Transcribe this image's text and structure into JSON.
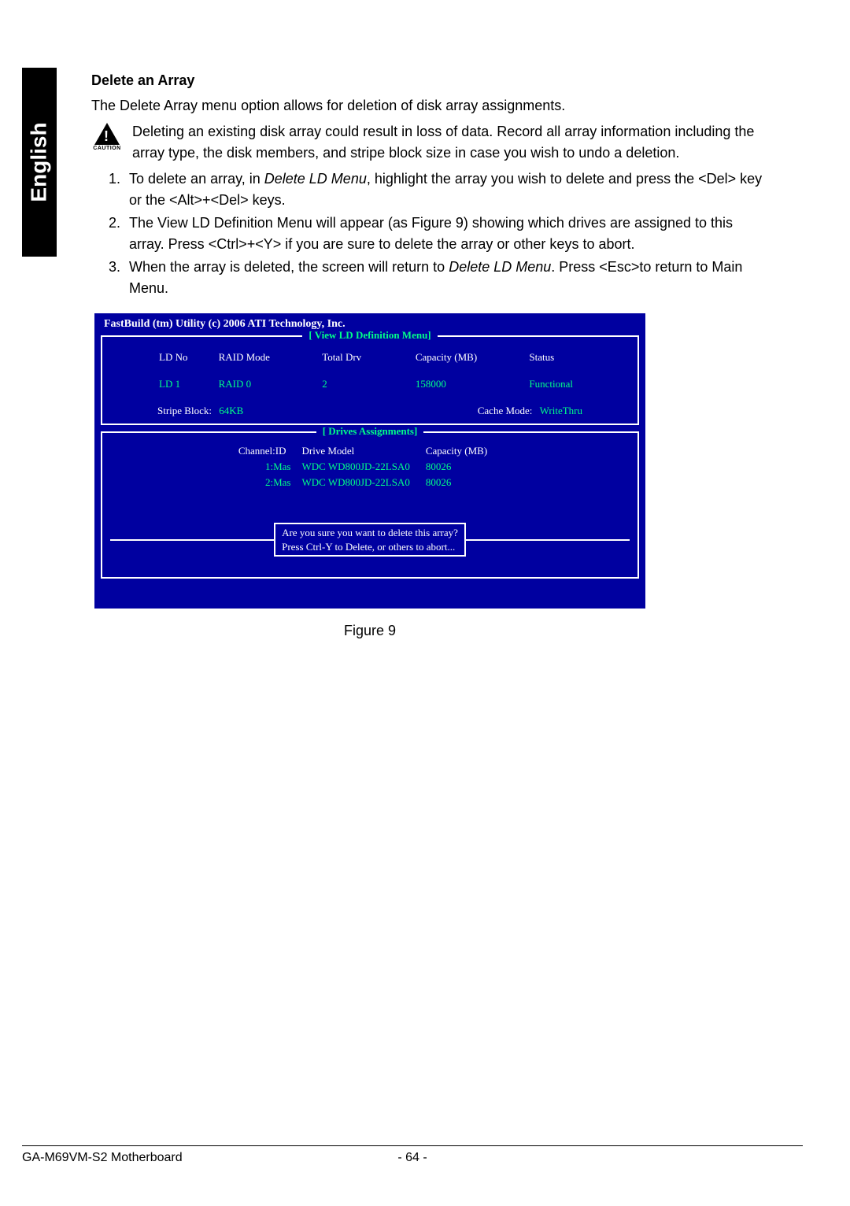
{
  "sideTab": "English",
  "section": {
    "title": "Delete an Array",
    "intro": "The Delete Array menu option allows for deletion of disk array assignments.",
    "cautionLabel": "CAUTION",
    "cautionText": "Deleting an existing disk array could result in loss of data. Record all array information including the array type, the disk members, and stripe block size in case you wish to undo a deletion."
  },
  "steps": [
    {
      "pre": "To delete an array, in ",
      "em": "Delete LD Menu",
      "post": ", highlight the array you wish to delete and press the <Del> key or the <Alt>+<Del> keys."
    },
    {
      "text": "The View LD Definition Menu will appear (as Figure 9) showing which drives are assigned to this array. Press <Ctrl>+<Y> if you are sure to delete the array or other keys to abort."
    },
    {
      "pre": "When the array is deleted, the screen will return to ",
      "em": "Delete LD Menu",
      "post": ". Press <Esc>to return to Main Menu."
    }
  ],
  "bios": {
    "title": "FastBuild (tm) Utility (c) 2006 ATI Technology, Inc.",
    "viewMenu": {
      "heading": "[  View LD Definition Menu]",
      "headers": {
        "c1": "LD No",
        "c2": "RAID Mode",
        "c3": "Total Drv",
        "c4": "Capacity (MB)",
        "c5": "Status"
      },
      "row": {
        "c1": "LD   1",
        "c2": "RAID 0",
        "c3": "2",
        "c4": "158000",
        "c5": "Functional"
      },
      "stripeLabel": "Stripe Block:",
      "stripeVal": "64KB",
      "cacheLabel": "Cache Mode:",
      "cacheVal": "WriteThru"
    },
    "drives": {
      "heading": "[  Drives Assignments]",
      "headers": {
        "c1": "Channel:ID",
        "c2": "Drive Model",
        "c3": "Capacity (MB)"
      },
      "rows": [
        {
          "c1": "1:Mas",
          "c2": "WDC WD800JD-22LSA0",
          "c3": "80026"
        },
        {
          "c1": "2:Mas",
          "c2": "WDC WD800JD-22LSA0",
          "c3": "80026"
        }
      ],
      "promptLine1": "Are you sure you want to delete this array?",
      "promptLine2": "Press Ctrl-Y to Delete, or others to abort..."
    }
  },
  "figureCaption": "Figure 9",
  "footer": {
    "model": "GA-M69VM-S2 Motherboard",
    "page": "- 64 -"
  }
}
